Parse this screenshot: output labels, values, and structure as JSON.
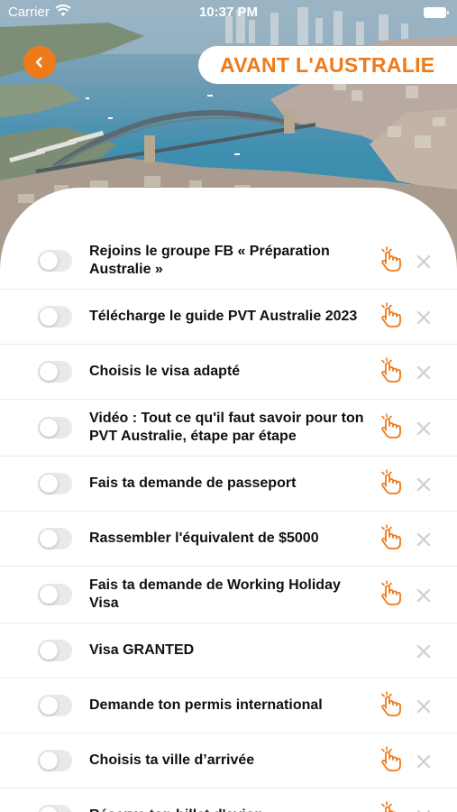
{
  "status_bar": {
    "carrier": "Carrier",
    "time": "10:37 PM"
  },
  "header": {
    "title": "AVANT L'AUSTRALIE",
    "back_icon": "chevron-left-icon"
  },
  "colors": {
    "accent": "#ef7a1a",
    "toggle_off": "#e9e9eb",
    "close_gray": "#cfcfcf",
    "text": "#111111"
  },
  "checklist": {
    "items": [
      {
        "label": "Rejoins le groupe FB « Préparation Australie »",
        "checked": false,
        "has_tap_icon": true
      },
      {
        "label": "Télécharge le guide PVT Australie 2023",
        "checked": false,
        "has_tap_icon": true
      },
      {
        "label": "Choisis le visa adapté",
        "checked": false,
        "has_tap_icon": true
      },
      {
        "label": "Vidéo : Tout ce qu'il faut savoir pour ton PVT Australie, étape par étape",
        "checked": false,
        "has_tap_icon": true
      },
      {
        "label": "Fais ta demande de passeport",
        "checked": false,
        "has_tap_icon": true
      },
      {
        "label": "Rassembler l'équivalent de $5000",
        "checked": false,
        "has_tap_icon": true
      },
      {
        "label": "Fais ta demande de Working Holiday Visa",
        "checked": false,
        "has_tap_icon": true
      },
      {
        "label": "Visa GRANTED",
        "checked": false,
        "has_tap_icon": false
      },
      {
        "label": "Demande ton permis international",
        "checked": false,
        "has_tap_icon": true
      },
      {
        "label": "Choisis ta ville d’arrivée",
        "checked": false,
        "has_tap_icon": true
      },
      {
        "label": "Réserve ton billet d'avion",
        "checked": false,
        "has_tap_icon": true
      }
    ]
  }
}
